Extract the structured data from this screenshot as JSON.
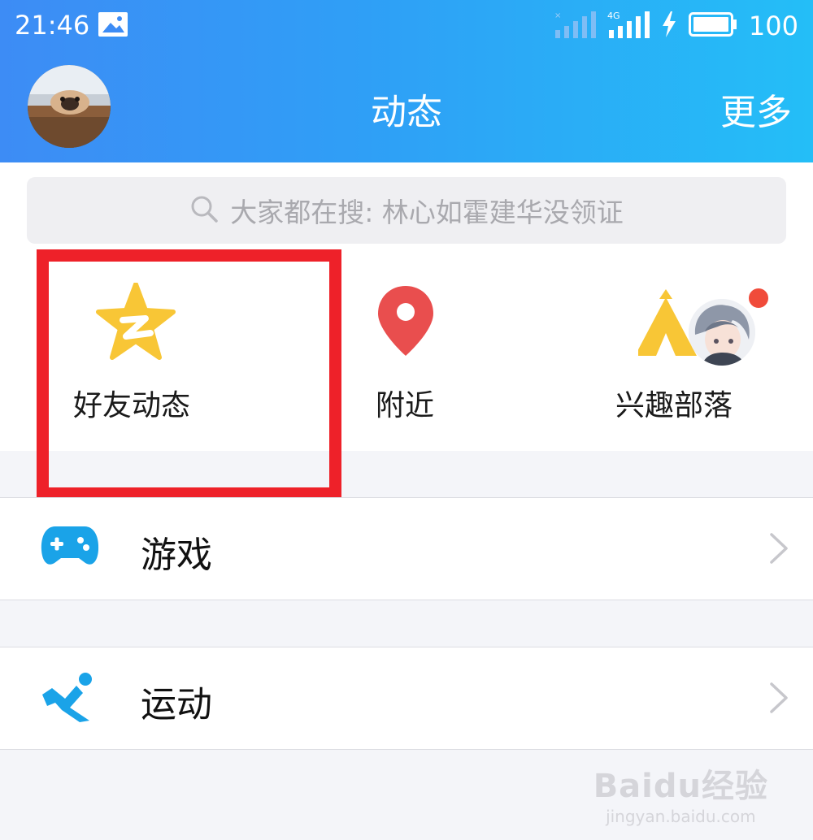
{
  "status_bar": {
    "time": "21:46",
    "network": "4G",
    "battery": "100"
  },
  "header": {
    "title": "动态",
    "more": "更多"
  },
  "search": {
    "placeholder": "大家都在搜: 林心如霍建华没领证"
  },
  "entries": [
    {
      "label": "好友动态",
      "icon": "qzone-star-icon"
    },
    {
      "label": "附近",
      "icon": "location-pin-icon"
    },
    {
      "label": "兴趣部落",
      "icon": "tribe-tent-icon"
    }
  ],
  "list": [
    {
      "label": "游戏",
      "icon": "gamepad-icon"
    },
    {
      "label": "运动",
      "icon": "running-icon"
    }
  ],
  "watermark": {
    "brand": "Baidu经验",
    "url": "jingyan.baidu.com"
  },
  "colors": {
    "header_start": "#3d8cf5",
    "header_end": "#24bef7",
    "highlight": "#ee2129",
    "game_blue": "#1aa3e8",
    "pin_red": "#e94e4e",
    "star_yellow": "#f8c636"
  }
}
